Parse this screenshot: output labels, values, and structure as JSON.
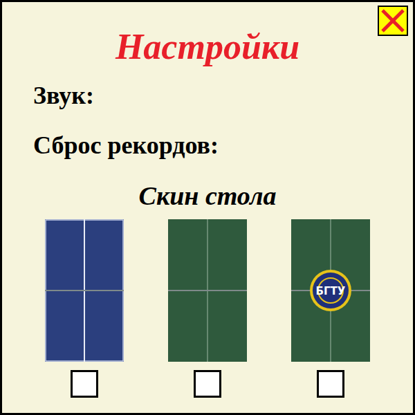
{
  "window": {
    "title": "Настройки"
  },
  "settings": [
    {
      "label": "Звук:"
    },
    {
      "label": "Сброс рекордов:"
    }
  ],
  "skins": {
    "title": "Скин стола",
    "items": [
      {
        "kind": "plain",
        "color": "#2b3f7e",
        "selected": false
      },
      {
        "kind": "plain",
        "color": "#2f5a3d",
        "selected": false
      },
      {
        "kind": "logo",
        "color": "#2f5a3d",
        "logo": "БГТУ",
        "selected": false
      }
    ]
  }
}
